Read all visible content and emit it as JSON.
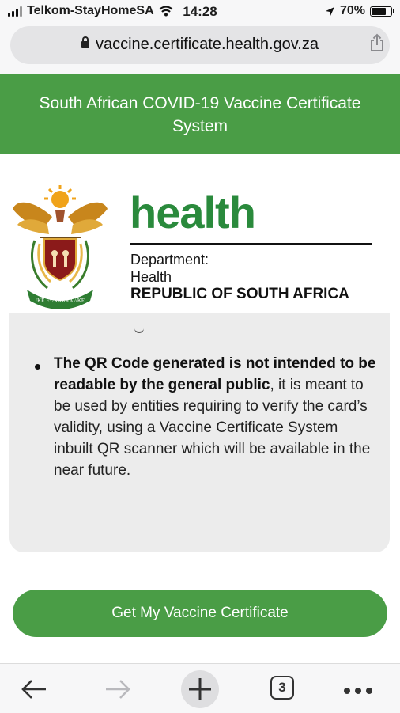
{
  "status_bar": {
    "carrier": "Telkom-StayHomeSA",
    "time": "14:28",
    "battery": "70%",
    "icons": [
      "signal-icon",
      "wifi-icon",
      "location-icon",
      "battery-icon"
    ]
  },
  "browser": {
    "url": "vaccine.certificate.health.gov.za",
    "icons": [
      "lock-icon",
      "share-icon"
    ]
  },
  "header": {
    "title": "South African COVID-19 Vaccine Certificate System",
    "color": "#4a9d46"
  },
  "logo": {
    "wordmark": "health",
    "wordmark_color": "#2a8a3c",
    "department_line1": "Department:",
    "department_line2": "Health",
    "country": "REPUBLIC OF SOUTH AFRICA",
    "coat_of_arms_motto": "!KE E: /XARRA //KE"
  },
  "info": {
    "bullet_bold": "The QR Code generated is not intended to be readable by the general public",
    "bullet_rest": ", it is meant to be used by entities requiring to verify the card’s validity, using a Vaccine Certificate System inbuilt QR scanner which will be available in the near future."
  },
  "cta": {
    "label": "Get My Vaccine Certificate",
    "color": "#4a9d46"
  },
  "toolbar": {
    "tab_count": "3",
    "icons": [
      "back-arrow-icon",
      "forward-arrow-icon",
      "new-tab-plus-icon",
      "tab-switcher-icon",
      "more-dots-icon"
    ]
  }
}
